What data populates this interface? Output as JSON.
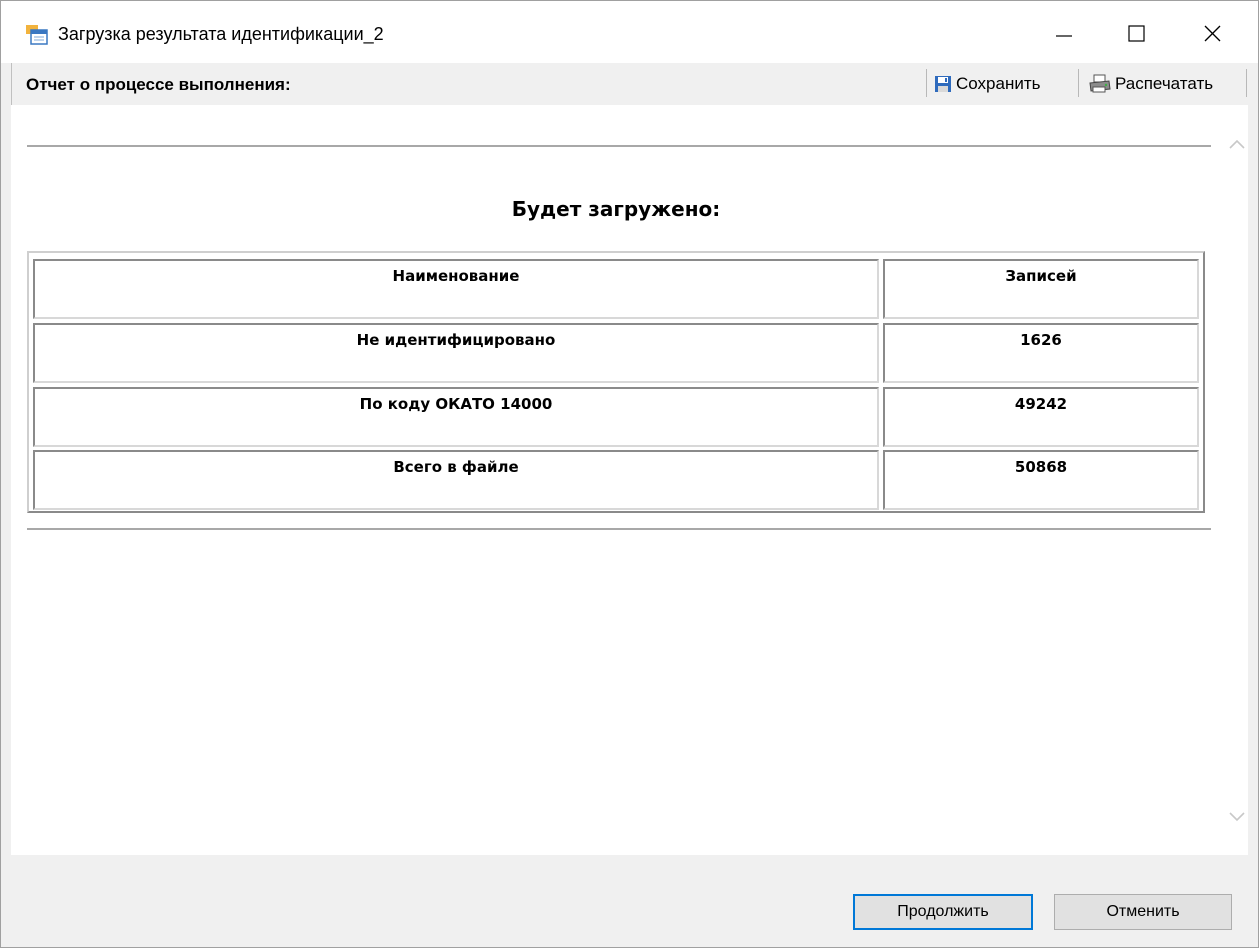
{
  "window": {
    "title": "Загрузка результата идентификации_2",
    "icon": "report-window-icon",
    "controls": [
      "minimize-icon",
      "maximize-icon",
      "close-icon"
    ]
  },
  "toolbar": {
    "label": "Отчет о процессе выполнения:",
    "save_label": "Сохранить",
    "save_icon": "floppy-disk-icon",
    "print_label": "Распечатать",
    "print_icon": "printer-icon"
  },
  "report": {
    "title": "Будет загружено:",
    "columns": [
      "Наименование",
      "Записей"
    ],
    "rows": [
      {
        "name": "Не идентифицировано",
        "count": "1626"
      },
      {
        "name": "По коду ОКАТО 14000",
        "count": "49242"
      },
      {
        "name": "Всего в файле",
        "count": "50868"
      }
    ]
  },
  "footer": {
    "continue_label": "Продолжить",
    "cancel_label": "Отменить"
  },
  "colors": {
    "focus_border": "#0078d7",
    "button_bg": "#e1e1e1",
    "window_bg": "#f0f0f0"
  }
}
